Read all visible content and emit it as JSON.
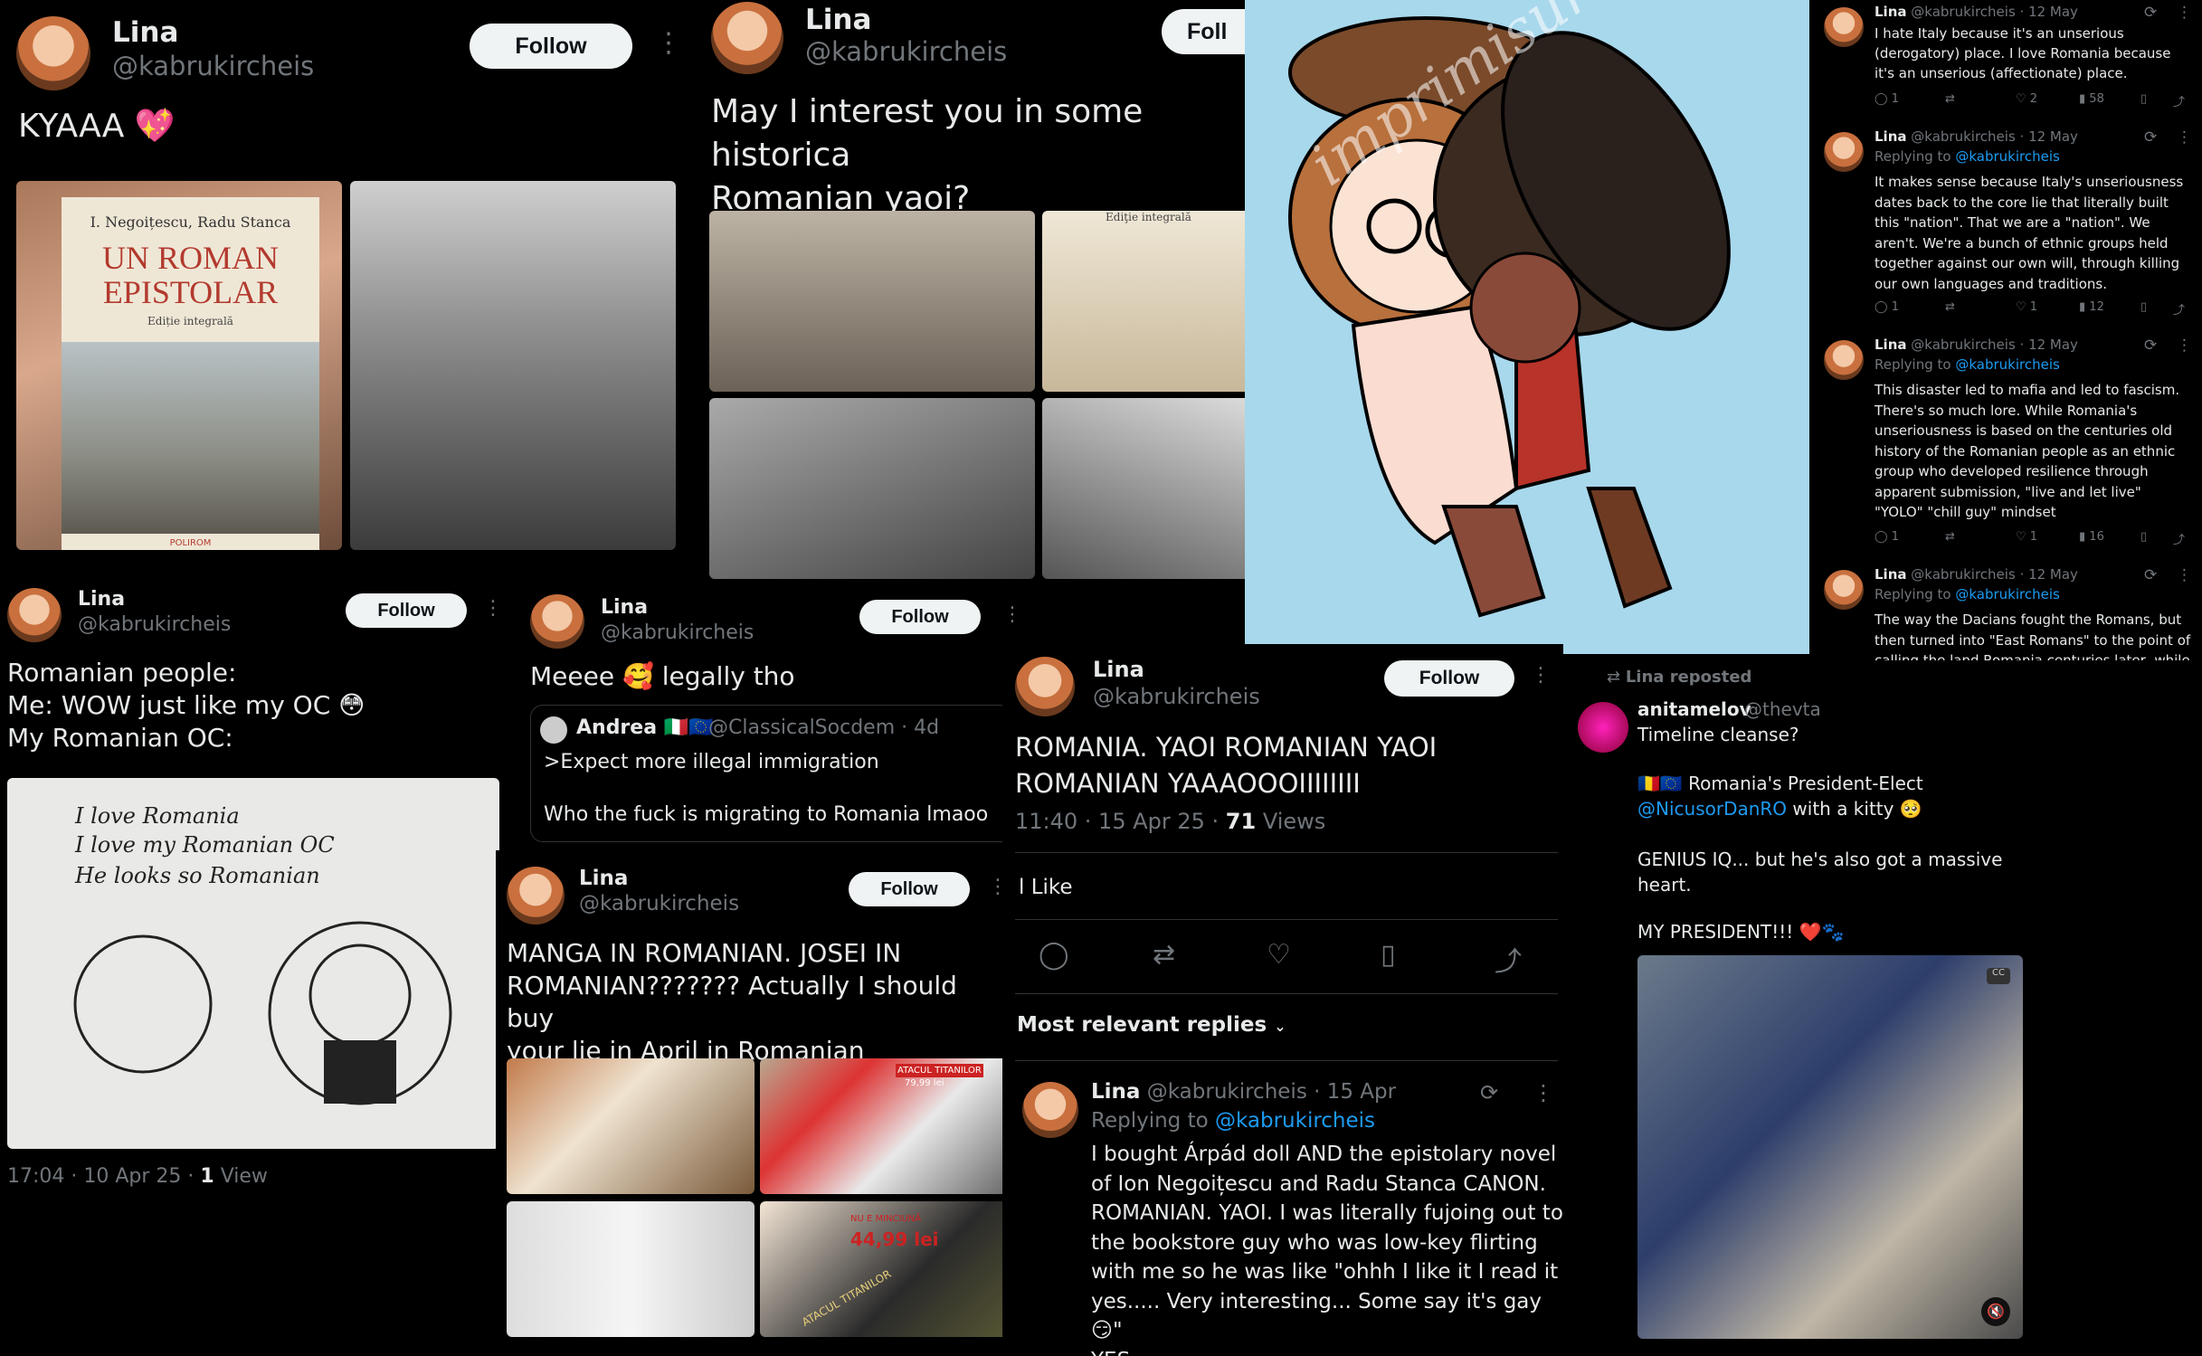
{
  "user": {
    "name": "Lina",
    "handle": "@kabrukircheis",
    "follow_label": "Follow"
  },
  "post1": {
    "text": "KYAAA 💖",
    "book": {
      "authors": "I. Negoițescu, Radu Stanca",
      "title": "UN ROMAN\nEPISTOLAR",
      "edition": "Ediție integrală",
      "publisher": "POLIROM"
    }
  },
  "post2": {
    "text": "May I interest you in some historica\nRomanian yaoi?",
    "follow_label": "Foll",
    "book_edition": "Ediţie integrală"
  },
  "art": {
    "watermark": "imprimisura"
  },
  "thread": {
    "t1": {
      "meta": "@kabrukircheis · 12 May",
      "text": "I hate Italy because it's an unserious (derogatory) place. I love Romania because it's an unserious (affectionate) place.",
      "stats": [
        "1",
        "",
        "2",
        "58"
      ]
    },
    "t2": {
      "meta": "@kabrukircheis · 12 May",
      "replying": "Replying to",
      "to": "@kabrukircheis",
      "text": "It makes sense because Italy's unseriousness dates back to the core lie that literally built this \"nation\". That we are a \"nation\". We aren't. We're a bunch of ethnic groups held together against our own will, through killing our own languages and traditions.",
      "stats": [
        "1",
        "",
        "1",
        "12"
      ]
    },
    "t3": {
      "meta": "@kabrukircheis · 12 May",
      "replying": "Replying to",
      "to": "@kabrukircheis",
      "text": "This disaster led to mafia and led to fascism. There's so much lore. While Romania's unseriousness is based on the centuries old history of the Romanian people as an ethnic group who developed resilience through apparent submission, \"live and let live\" \"YOLO\" \"chill guy\" mindset",
      "stats": [
        "1",
        "",
        "1",
        "16"
      ]
    },
    "t4": {
      "meta": "@kabrukircheis · 12 May",
      "replying": "Replying to",
      "to": "@kabrukircheis",
      "text": "The way the Dacians fought the Romans, but then turned into \"East Romans\" to the point of calling the land Romania centuries later, while keeping their Dacian identity alive to this day. The way they've been influenced by Slavs but never turned Slavs (Thracians L). The way theyve"
    }
  },
  "post3": {
    "text": "Romanian people:\nMe: WOW just like my OC 😳\nMy Romanian OC:",
    "drawing": {
      "line1": "I love Romania",
      "line2": "I love my Romanian OC",
      "line3": "He looks so Romanian"
    },
    "time": "17:04 · 10 Apr 25 · ",
    "views_n": "1",
    "views_l": " View"
  },
  "post4": {
    "text": "Meeee 🥰 legally tho",
    "quote": {
      "name": "Andrea 🇮🇹🇪🇺",
      "meta": "@ClassicalSocdem · 4d",
      "line1": ">Expect more illegal immigration",
      "line2": "Who the fuck is migrating to Romania lmaoo"
    }
  },
  "post5": {
    "text": "MANGA IN ROMANIAN. JOSEI IN\nROMANIAN??????? Actually I should buy\nyour lie in April in Romanian",
    "img_labels": {
      "a": "ATACUL TITANILOR",
      "b": "79,99 lei",
      "c": "NU E MINCIUNĂ",
      "d": "44,99 lei",
      "e": "ATACUL TITANILOR"
    }
  },
  "post6": {
    "text": "ROMANIA. YAOI ROMANIAN YAOI\nROMANIAN YAAAOOOIIIIIIII",
    "time": "11:40 · 15 Apr 25 · ",
    "views_n": "71",
    "views_l": " Views",
    "like_label": "l Like",
    "replies_label": "Most relevant replies",
    "reply": {
      "meta": "@kabrukircheis · 15 Apr",
      "replying": "Replying to",
      "to": "@kabrukircheis",
      "text": "I bought Árpád doll AND the epistolary novel\nof Ion Negoițescu and Radu Stanca CANON.\nROMANIAN. YAOI. I was literally fujoing out to\nthe bookstore guy who was low-key flirting\nwith me so he was like \"ohhh  I like it I read it\nyes..... Very interesting... Some say it's gay 😏\"\nYES"
    }
  },
  "repost": {
    "label": "Lina reposted",
    "name": "anitamelov",
    "handle": "@thevta",
    "text": "Timeline cleanse?",
    "l1a": "🇷🇴🇪🇺 Romania's President-Elect",
    "l2a": "@NicusorDanRO",
    "l2b": " with a kitty 🥺",
    "l3": "GENIUS IQ... but he's also got a massive\nheart.",
    "l4": "MY PRESIDENT!!! ❤️🐾"
  }
}
